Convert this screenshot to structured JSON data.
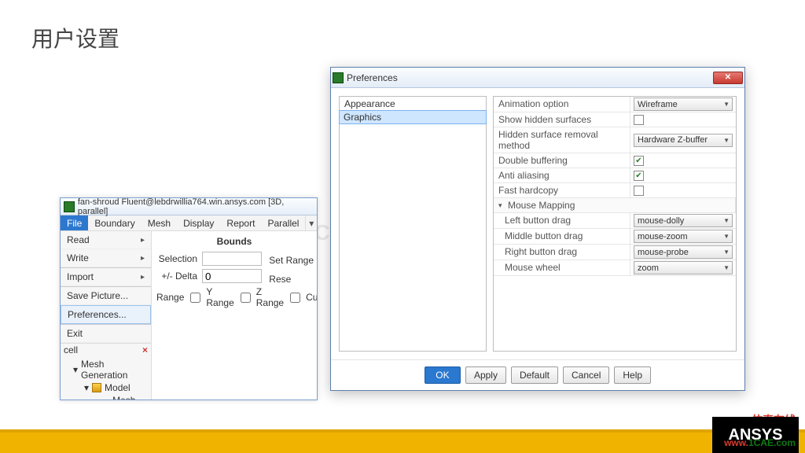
{
  "slide": {
    "title": "用户设置",
    "watermark": "1CAE.COM"
  },
  "fluent": {
    "title": "fan-shroud Fluent@lebdrwillia764.win.ansys.com [3D, parallel]",
    "menus": [
      "File",
      "Boundary",
      "Mesh",
      "Display",
      "Report",
      "Parallel"
    ],
    "menu_caret": "▾",
    "file_menu": {
      "items": [
        {
          "label": "Read",
          "arrow": true
        },
        {
          "label": "Write",
          "arrow": true
        },
        {
          "label": "Import",
          "arrow": true
        },
        {
          "label": "Save Picture...",
          "arrow": false
        },
        {
          "label": "Preferences...",
          "arrow": false,
          "highlight": true
        },
        {
          "label": "Exit",
          "arrow": false
        }
      ]
    },
    "bounds": {
      "title": "Bounds",
      "selection_label": "Selection",
      "delta_label": "+/- Delta",
      "delta_value": "0",
      "range_row": "Range",
      "y_range": "Y Range",
      "z_range": "Z Range",
      "set_range": "Set Range",
      "reset": "Rese",
      "cutplane": "Cutplar"
    },
    "cell_header": "cell",
    "tree": {
      "root": "Mesh Generation",
      "model": "Model",
      "objects": "Mesh Objects"
    }
  },
  "prefs": {
    "title": "Preferences",
    "categories": [
      "Appearance",
      "Graphics"
    ],
    "selected_index": 1,
    "rows": [
      {
        "label": "Animation option",
        "type": "select",
        "value": "Wireframe"
      },
      {
        "label": "Show hidden surfaces",
        "type": "check",
        "value": false
      },
      {
        "label": "Hidden surface removal method",
        "type": "select",
        "value": "Hardware Z-buffer"
      },
      {
        "label": "Double buffering",
        "type": "check",
        "value": true
      },
      {
        "label": "Anti aliasing",
        "type": "check",
        "value": true
      },
      {
        "label": "Fast hardcopy",
        "type": "check",
        "value": false
      },
      {
        "label": "Mouse Mapping",
        "type": "group"
      },
      {
        "label": "Left button drag",
        "type": "select",
        "value": "mouse-dolly",
        "indent": true
      },
      {
        "label": "Middle button drag",
        "type": "select",
        "value": "mouse-zoom",
        "indent": true
      },
      {
        "label": "Right button drag",
        "type": "select",
        "value": "mouse-probe",
        "indent": true
      },
      {
        "label": "Mouse wheel",
        "type": "select",
        "value": "zoom",
        "indent": true
      }
    ],
    "buttons": {
      "ok": "OK",
      "apply": "Apply",
      "default": "Default",
      "cancel": "Cancel",
      "help": "Help"
    }
  },
  "footer": {
    "brand": "ANSYS",
    "cn": "仿真在线",
    "url_w": "www.",
    "url_d": "1CAE.com"
  }
}
